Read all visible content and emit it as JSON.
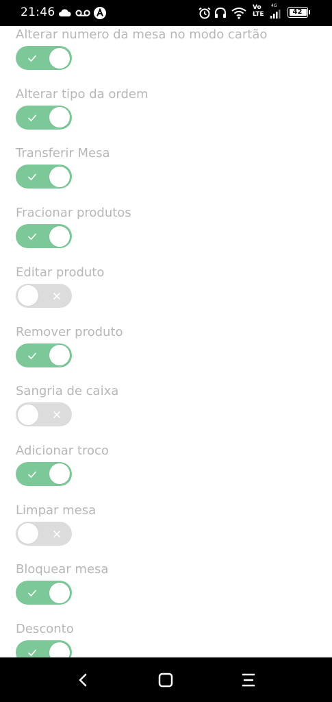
{
  "status_bar": {
    "time": "21:46",
    "battery_level": "42",
    "network_label_top": "Vo",
    "network_label_bottom": "LTE",
    "signal_label": "4G",
    "icons": [
      "cloud-icon",
      "voicemail-icon",
      "app-badge-icon",
      "alarm-icon",
      "headphones-icon",
      "wifi-icon",
      "signal-icon",
      "battery-icon"
    ]
  },
  "settings": [
    {
      "label": "Alterar numero da mesa no modo cartão",
      "enabled": true
    },
    {
      "label": "Alterar tipo da ordem",
      "enabled": true
    },
    {
      "label": "Transferir Mesa",
      "enabled": true
    },
    {
      "label": "Fracionar produtos",
      "enabled": true
    },
    {
      "label": "Editar produto",
      "enabled": false
    },
    {
      "label": "Remover produto",
      "enabled": true
    },
    {
      "label": "Sangria de caixa",
      "enabled": false
    },
    {
      "label": "Adicionar troco",
      "enabled": true
    },
    {
      "label": "Limpar mesa",
      "enabled": false
    },
    {
      "label": "Bloquear mesa",
      "enabled": true
    },
    {
      "label": "Desconto",
      "enabled": true
    }
  ],
  "colors": {
    "toggle_on": "#7cc898",
    "toggle_off": "#dcdcdc",
    "label_text": "#b7b7b7",
    "system_bars": "#000000"
  },
  "nav_bar": {
    "icons": [
      "back-icon",
      "home-icon",
      "recents-icon"
    ]
  }
}
